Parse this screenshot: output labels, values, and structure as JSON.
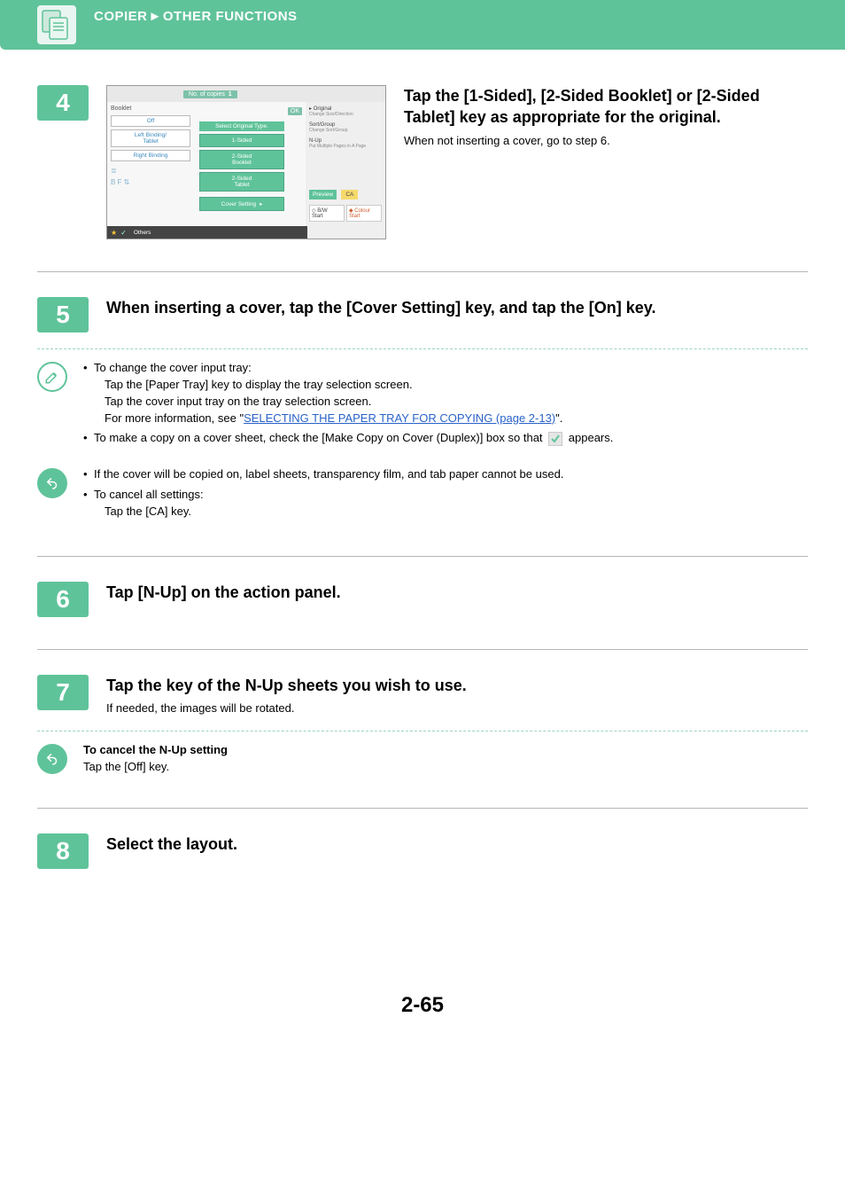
{
  "header": {
    "breadcrumb_a": "COPIER",
    "breadcrumb_b": "OTHER FUNCTIONS"
  },
  "mock": {
    "copies_label": "No. of copies",
    "copies_value": "1",
    "booklet_label": "Booklet",
    "ok": "OK",
    "left_opts": {
      "off": "Off",
      "leftbind": "Left Binding/\nTablet",
      "rightbind": "Right Binding"
    },
    "center_hdr": "Select Original Type.",
    "center_opts": {
      "one": "1-Sided",
      "twoB": "2-Sided\nBooklet",
      "twoT": "2-Sided\nTablet"
    },
    "cover_setting": "Cover Setting",
    "right_items": {
      "original": "Original",
      "original_sub": "Change Size/Direction",
      "sort": "Sort/Group",
      "sort_sub": "Change Sort/Group",
      "nup": "N-Up",
      "nup_sub": "Put Multiple Pages in A Page"
    },
    "preview": "Preview",
    "ca": "CA",
    "bw_start": "B/W\nStart",
    "colour_start": "Colour\nStart",
    "others": "Others"
  },
  "steps": {
    "s4": {
      "num": "4",
      "title": "Tap the [1-Sided], [2-Sided Booklet] or [2-Sided Tablet] key as appropriate for the original.",
      "sub": "When not inserting a cover, go to step 6."
    },
    "s5": {
      "num": "5",
      "title": "When inserting a cover, tap the [Cover Setting] key, and tap the [On] key.",
      "note1_head": "To change the cover input tray:",
      "note1_l1": "Tap the [Paper Tray] key to display the tray selection screen.",
      "note1_l2": "Tap the cover input tray on the tray selection screen.",
      "note1_l3_a": "For more information, see \"",
      "note1_link": "SELECTING THE PAPER TRAY FOR COPYING (page 2-13)",
      "note1_l3_b": "\".",
      "note1_bullet2_a": "To make a copy on a cover sheet, check the [Make Copy on Cover (Duplex)] box so that ",
      "note1_bullet2_b": " appears.",
      "note2_b1": "If the cover will be copied on, label sheets, transparency film, and tab paper cannot be used.",
      "note2_b2": "To cancel all settings:",
      "note2_b2_sub": "Tap the [CA] key."
    },
    "s6": {
      "num": "6",
      "title": "Tap [N-Up] on the action panel."
    },
    "s7": {
      "num": "7",
      "title": "Tap the key of the N-Up sheets you wish to use.",
      "sub": "If needed, the images will be rotated.",
      "note_head": "To cancel the N-Up setting",
      "note_body": "Tap the [Off] key."
    },
    "s8": {
      "num": "8",
      "title": "Select the layout."
    }
  },
  "page_number": "2-65"
}
